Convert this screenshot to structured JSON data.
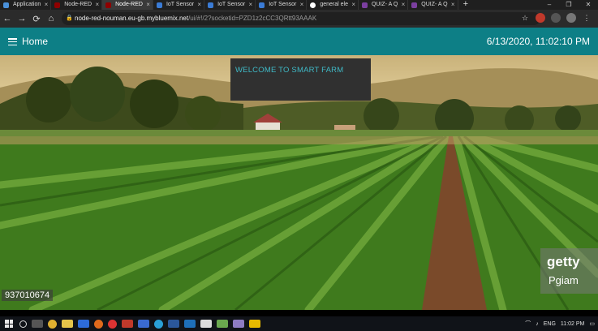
{
  "browser": {
    "tabs": [
      {
        "label": "Application",
        "active": false,
        "icon": "apps-icon",
        "color": "#4a90d9"
      },
      {
        "label": "Node-RED",
        "active": false,
        "icon": "node-red-icon",
        "color": "#8f0000"
      },
      {
        "label": "Node-RED",
        "active": true,
        "icon": "node-red-icon",
        "color": "#8f0000"
      },
      {
        "label": "IoT Sensor",
        "active": false,
        "icon": "ibm-cloud-icon",
        "color": "#3a7bd5"
      },
      {
        "label": "IoT Sensor",
        "active": false,
        "icon": "ibm-cloud-icon",
        "color": "#3a7bd5"
      },
      {
        "label": "IoT Sensor",
        "active": false,
        "icon": "ibm-cloud-icon",
        "color": "#3a7bd5"
      },
      {
        "label": "general ele",
        "active": false,
        "icon": "google-icon",
        "color": "#ffffff"
      },
      {
        "label": "QUIZ- A Q",
        "active": false,
        "icon": "forms-icon",
        "color": "#7b3fa0"
      },
      {
        "label": "QUIZ- A Q",
        "active": false,
        "icon": "forms-icon",
        "color": "#7b3fa0"
      }
    ],
    "url_host": "node-red-nouman.eu-gb.mybluemix.net",
    "url_path": "/ui/#!/2?socketid=PZD1z2cCC3QRtt93AAAK"
  },
  "app": {
    "title": "Home",
    "datetime": "6/13/2020, 11:02:10 PM",
    "header_color": "#0d7f86"
  },
  "main": {
    "welcome_text": "WELCOME TO SMART FARM",
    "watermark_brand": "getty",
    "watermark_sub": "Pgiam",
    "image_id": "937010674"
  },
  "taskbar": {
    "language": "ENG",
    "time": "11:02 PM"
  }
}
